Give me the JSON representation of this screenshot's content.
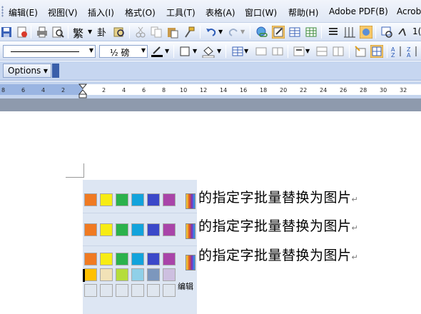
{
  "menu": [
    "编辑(E)",
    "视图(V)",
    "插入(I)",
    "格式(O)",
    "工具(T)",
    "表格(A)",
    "窗口(W)",
    "帮助(H)",
    "Adobe PDF(B)",
    "Acrob"
  ],
  "toolbar": {
    "font_size_value": "½ 磅",
    "chinese_convert": "繁",
    "right_edge_value": "1("
  },
  "options": {
    "label": "Options"
  },
  "ruler": {
    "left_ticks": [
      "8",
      "6",
      "4",
      "2"
    ],
    "right_ticks": [
      "2",
      "4",
      "6",
      "8",
      "10",
      "12",
      "14",
      "16",
      "18",
      "20",
      "22",
      "24",
      "26",
      "28",
      "30",
      "32"
    ]
  },
  "document": {
    "lines": [
      "的指定字批量替换为图片",
      "的指定字批量替换为图片",
      "的指定字批量替换为图片"
    ],
    "paragraph_mark": "↵"
  },
  "picker": {
    "edit_label": "编辑",
    "colors": [
      "#f07a22",
      "#f7ec14",
      "#2bb24c",
      "#12a3dc",
      "#3b48c9",
      "#a944a9"
    ],
    "light_colors": [
      "#ffc000",
      "#f2e2b7",
      "#b5dd3b",
      "#8fd0e8",
      "#7c97bd",
      "#cdbfe0"
    ],
    "empty_color": "#dfe6ef"
  }
}
